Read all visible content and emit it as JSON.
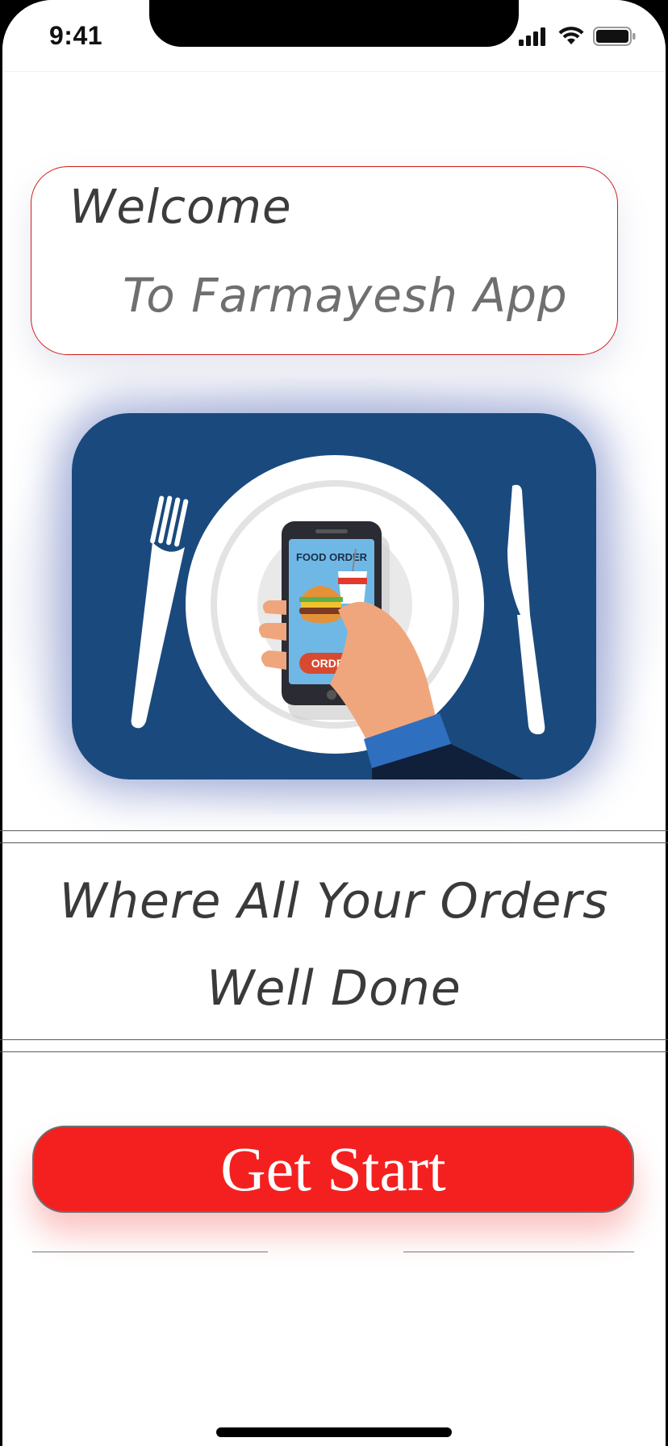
{
  "status_bar": {
    "time": "9:41",
    "icons": [
      "cellular-signal-icon",
      "wifi-icon",
      "battery-icon"
    ]
  },
  "welcome": {
    "line1": "Welcome",
    "line2": "To Farmayesh App"
  },
  "hero": {
    "phone_heading": "FOOD ORDER",
    "order_button_label": "ORDER",
    "icons": [
      "fork-icon",
      "knife-icon",
      "plate-icon",
      "smartphone-icon",
      "hand-icon",
      "burger-icon",
      "drink-cup-icon"
    ]
  },
  "tagline": {
    "line1": "Where All Your Orders",
    "line2": "Well Done"
  },
  "cta": {
    "label": "Get Start"
  },
  "colors": {
    "accent_red": "#f42020",
    "welcome_border": "#d11a1a",
    "hero_blue": "#1a4a7d"
  }
}
